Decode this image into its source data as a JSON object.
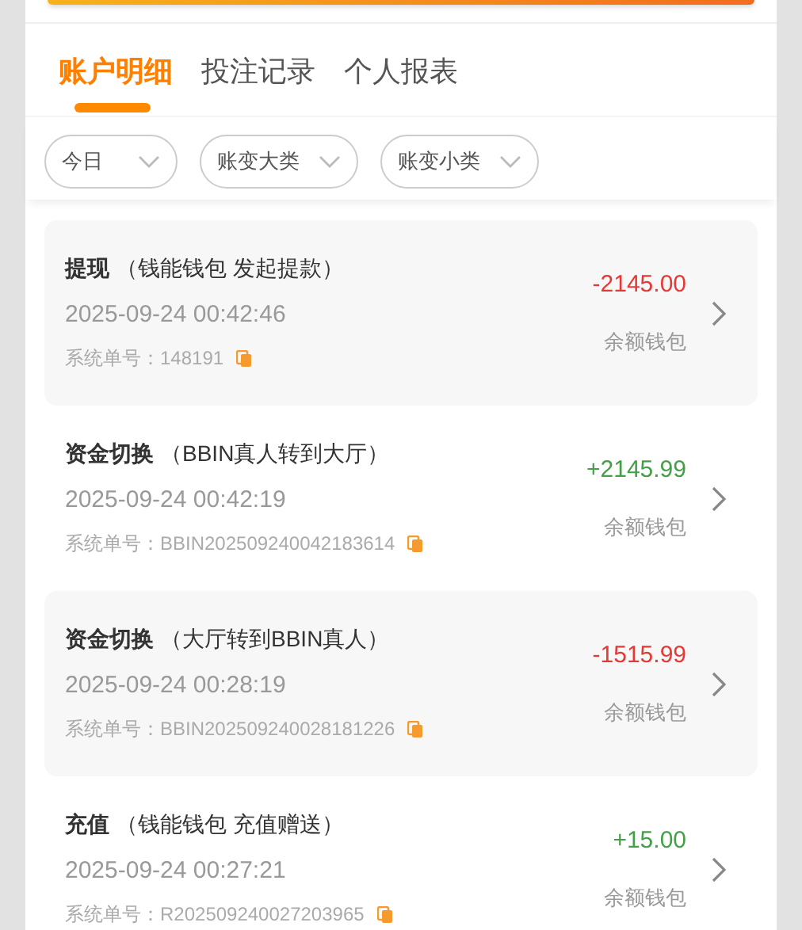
{
  "tabs": [
    {
      "label": "账户明细",
      "selected": true
    },
    {
      "label": "投注记录",
      "selected": false
    },
    {
      "label": "个人报表",
      "selected": false
    }
  ],
  "filters": [
    {
      "label": "今日"
    },
    {
      "label": "账变大类"
    },
    {
      "label": "账变小类"
    }
  ],
  "records": [
    {
      "type": "提现",
      "detail": "（钱能钱包 发起提款）",
      "time": "2025-09-24 00:42:46",
      "order_label": "系统单号：",
      "order_no": "148191",
      "amount": "-2145.00",
      "color": "#e53935",
      "wallet": "余额钱包"
    },
    {
      "type": "资金切换",
      "detail": "（BBIN真人转到大厅）",
      "time": "2025-09-24 00:42:19",
      "order_label": "系统单号：",
      "order_no": "BBIN202509240042183614",
      "amount": "+2145.99",
      "color": "#43a047",
      "wallet": "余额钱包"
    },
    {
      "type": "资金切换",
      "detail": "（大厅转到BBIN真人）",
      "time": "2025-09-24 00:28:19",
      "order_label": "系统单号：",
      "order_no": "BBIN202509240028181226",
      "amount": "-1515.99",
      "color": "#e53935",
      "wallet": "余额钱包"
    },
    {
      "type": "充值",
      "detail": "（钱能钱包 充值赠送）",
      "time": "2025-09-24 00:27:21",
      "order_label": "系统单号：",
      "order_no": "R202509240027203965",
      "amount": "+15.00",
      "color": "#43a047",
      "wallet": "余额钱包"
    }
  ]
}
